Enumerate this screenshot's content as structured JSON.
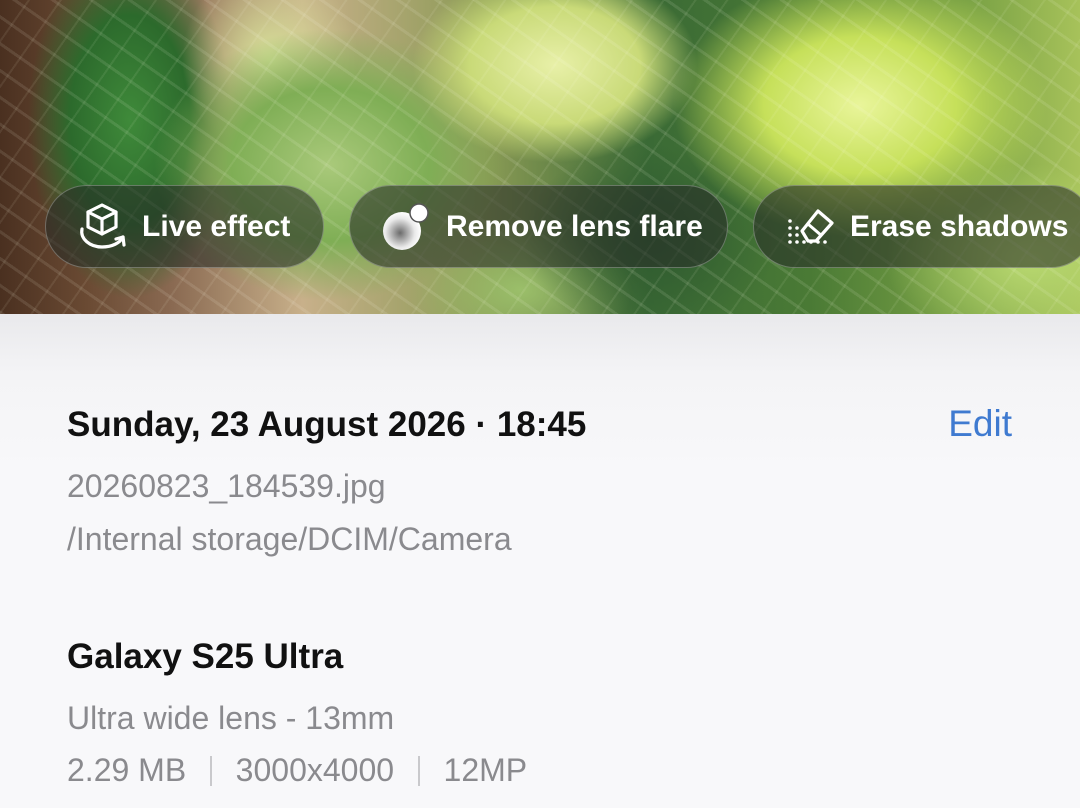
{
  "actions": {
    "live_effect": "Live effect",
    "remove_lens_flare": "Remove lens flare",
    "erase_shadows": "Erase shadows"
  },
  "details": {
    "datetime": "Sunday, 23 August 2026 · 18:45",
    "edit_label": "Edit",
    "filename": "20260823_184539.jpg",
    "path": "/Internal storage/DCIM/Camera",
    "device": "Galaxy S25 Ultra",
    "lens": "Ultra wide lens - 13mm",
    "file_size": "2.29 MB",
    "resolution": "3000x4000",
    "megapixels": "12MP"
  },
  "colors": {
    "accent": "#3f7ad0",
    "secondary_text": "#8a8a8e",
    "primary_text": "#111111"
  },
  "icons": [
    "cube-rotate-icon",
    "lens-flare-icon",
    "eraser-icon"
  ]
}
